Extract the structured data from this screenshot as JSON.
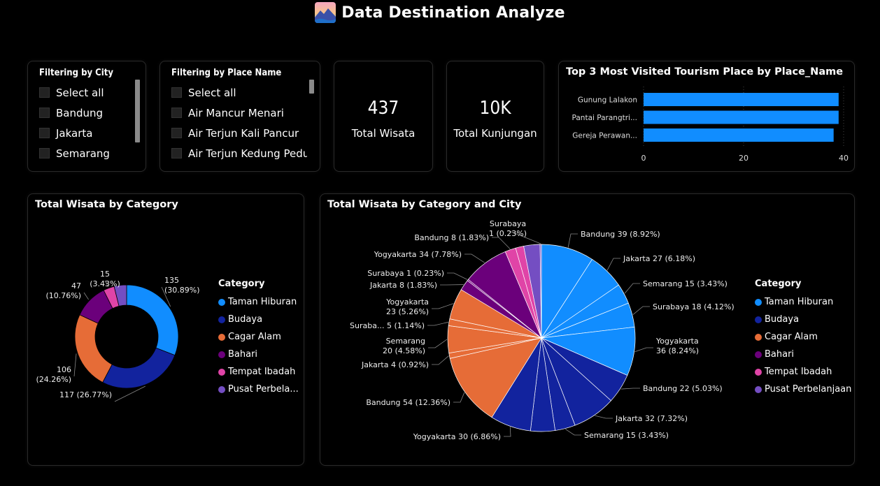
{
  "header": {
    "title": "Data Destination Analyze",
    "logo_icon": "mountain-sunset-icon"
  },
  "colors": {
    "taman_hiburan": "#118DFF",
    "budaya": "#12239E",
    "cagar_alam": "#E66C37",
    "bahari": "#6B007B",
    "tempat_ibadah": "#E044A7",
    "pusat_perbelanjaan": "#744EC2",
    "bar": "#118DFF"
  },
  "city_slicer": {
    "title": "Filtering by City",
    "items": [
      "Select all",
      "Bandung",
      "Jakarta",
      "Semarang"
    ]
  },
  "place_slicer": {
    "title": "Filtering by Place Name",
    "items": [
      "Select all",
      "Air Mancur Menari",
      "Air Terjun Kali Pancur",
      "Air Terjun Kedung Pedut"
    ]
  },
  "kpi_total_wisata": {
    "value": "437",
    "label": "Total Wisata"
  },
  "kpi_total_kunjungan": {
    "value": "10K",
    "label": "Total Kunjungan"
  },
  "chart_data": [
    {
      "type": "bar",
      "orientation": "horizontal",
      "title": "Top 3 Most Visited Tourism Place by Place_Name",
      "categories": [
        "Gunung Lalakon",
        "Pantai Parangtri...",
        "Gereja Perawan..."
      ],
      "values": [
        39,
        39,
        38
      ],
      "xlim": [
        0,
        40
      ],
      "xticks": [
        "0",
        "20",
        "40"
      ]
    },
    {
      "type": "pie",
      "variant": "donut",
      "title": "Total Wisata by Category",
      "legend_title": "Category",
      "legend_position": "right",
      "categories": [
        "Taman Hiburan",
        "Budaya",
        "Cagar Alam",
        "Bahari",
        "Tempat Ibadah",
        "Pusat Perbela..."
      ],
      "values": [
        135,
        117,
        106,
        47,
        15,
        17
      ],
      "labels": [
        [
          "135",
          "(30.89%)"
        ],
        [
          "117 (26.77%)"
        ],
        [
          "106",
          "(24.26%)"
        ],
        [
          "47",
          "(10.76%)"
        ],
        [
          "15",
          "(3.43%)"
        ],
        []
      ]
    },
    {
      "type": "pie",
      "title": "Total Wisata by Category and City",
      "legend_title": "Category",
      "legend_position": "right",
      "legend": [
        "Taman Hiburan",
        "Budaya",
        "Cagar Alam",
        "Bahari",
        "Tempat Ibadah",
        "Pusat Perbelanjaan"
      ],
      "slices": [
        {
          "category": 0,
          "value": 39,
          "label": [
            "Bandung 39 (8.92%)"
          ]
        },
        {
          "category": 0,
          "value": 27,
          "label": [
            "Jakarta 27 (6.18%)"
          ]
        },
        {
          "category": 0,
          "value": 15,
          "label": [
            "Semarang 15 (3.43%)"
          ]
        },
        {
          "category": 0,
          "value": 18,
          "label": [
            "Surabaya 18 (4.12%)"
          ]
        },
        {
          "category": 0,
          "value": 36,
          "label": [
            "Yogyakarta",
            "36 (8.24%)"
          ]
        },
        {
          "category": 1,
          "value": 22,
          "label": [
            "Bandung 22 (5.03%)"
          ]
        },
        {
          "category": 1,
          "value": 32,
          "label": [
            "Jakarta 32 (7.32%)"
          ]
        },
        {
          "category": 1,
          "value": 15,
          "label": [
            "Semarang 15 (3.43%)"
          ]
        },
        {
          "category": 1,
          "value": 18,
          "label": []
        },
        {
          "category": 1,
          "value": 30,
          "label": [
            "Yogyakarta 30 (6.86%)"
          ]
        },
        {
          "category": 2,
          "value": 54,
          "label": [
            "Bandung 54 (12.36%)"
          ]
        },
        {
          "category": 2,
          "value": 4,
          "label": [
            "Jakarta 4 (0.92%)"
          ]
        },
        {
          "category": 2,
          "value": 20,
          "label": [
            "Semarang",
            "20 (4.58%)"
          ]
        },
        {
          "category": 2,
          "value": 5,
          "label": [
            "Suraba... 5 (1.14%)"
          ]
        },
        {
          "category": 2,
          "value": 23,
          "label": [
            "Yogyakarta",
            "23 (5.26%)"
          ]
        },
        {
          "category": 3,
          "value": 8,
          "label": [
            "Jakarta 8 (1.83%)"
          ]
        },
        {
          "category": 3,
          "value": 1,
          "label": [
            "Surabaya 1 (0.23%)"
          ]
        },
        {
          "category": 3,
          "value": 34,
          "label": [
            "Yogyakarta 34 (7.78%)"
          ]
        },
        {
          "category": 4,
          "value": 8,
          "label": [
            "Bandung 8 (1.83%)"
          ]
        },
        {
          "category": 4,
          "value": 6,
          "label": []
        },
        {
          "category": 5,
          "value": 12,
          "label": []
        },
        {
          "category": 5,
          "value": 1,
          "label": [
            "Surabaya",
            "1 (0.23%)"
          ]
        }
      ]
    }
  ]
}
